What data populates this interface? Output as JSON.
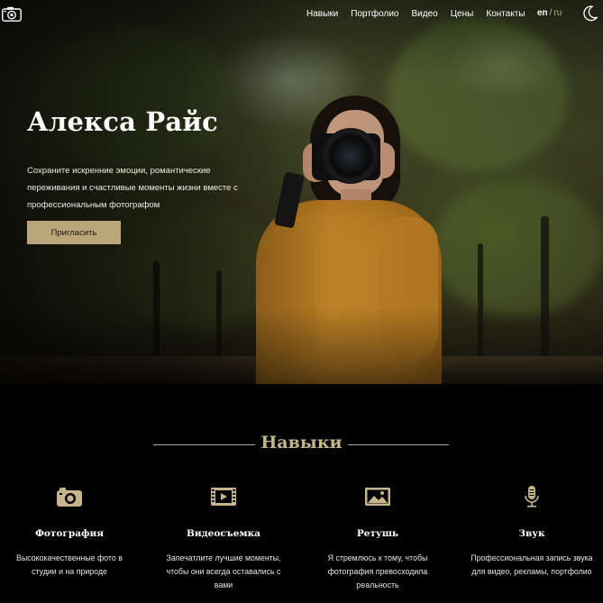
{
  "nav": {
    "items": [
      "Навыки",
      "Портфолио",
      "Видео",
      "Цены",
      "Контакты"
    ],
    "lang_en": "en",
    "lang_sep": "/",
    "lang_ru": "ru",
    "logo_icon": "camera-icon",
    "theme_icon": "moon-icon"
  },
  "hero": {
    "title": "Алекса Райс",
    "text": "Сохраните искренние эмоции, романтические переживания и счастливые моменты жизни вместе с профессиональным фотографом",
    "button": "Пригласить"
  },
  "skills": {
    "title": "Навыки",
    "items": [
      {
        "icon": "camera-icon",
        "name": "Фотография",
        "desc": "Высококачественные фото в студии и на природе"
      },
      {
        "icon": "film-icon",
        "name": "Видеосъемка",
        "desc": "Запечатлите лучшие моменты, чтобы они всегда оставались с вами"
      },
      {
        "icon": "image-icon",
        "name": "Ретушь",
        "desc": "Я стремлюсь к тому, чтобы фотография превосходила реальность"
      },
      {
        "icon": "microphone-icon",
        "name": "Звук",
        "desc": "Профессиональная запись звука для видео, рекламы, портфолио"
      }
    ]
  },
  "colors": {
    "accent": "#bba67a",
    "background": "#000000"
  }
}
